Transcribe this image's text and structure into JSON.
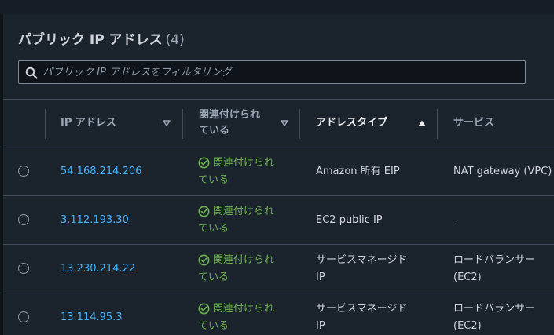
{
  "panel": {
    "title": "パブリック IP アドレス",
    "count": "(4)"
  },
  "search": {
    "placeholder": "パブリック IP アドレスをフィルタリング"
  },
  "table": {
    "columns": [
      {
        "label": "IP アドレス",
        "sortable": true,
        "sorted": false
      },
      {
        "label": "関連付けられている",
        "label_line1": "関連付けられ",
        "label_line2": "ている",
        "sortable": true,
        "sorted": false
      },
      {
        "label": "アドレスタイプ",
        "sortable": true,
        "sorted": "ascending"
      },
      {
        "label": "サービス",
        "sortable": false,
        "sorted": false
      }
    ],
    "rows": [
      {
        "ip": "54.168.214.206",
        "status_line1": "関連付けられ",
        "status_line2": "ている",
        "address_type_line1": "Amazon 所有 EIP",
        "address_type_line2": "",
        "service_line1": "NAT gateway (VPC)",
        "service_line2": ""
      },
      {
        "ip": "3.112.193.30",
        "status_line1": "関連付けられ",
        "status_line2": "ている",
        "address_type_line1": "EC2 public IP",
        "address_type_line2": "",
        "service_line1": "–",
        "service_line2": ""
      },
      {
        "ip": "13.230.214.22",
        "status_line1": "関連付けられ",
        "status_line2": "ている",
        "address_type_line1": "サービスマネージド",
        "address_type_line2": "IP",
        "service_line1": "ロードバランサー",
        "service_line2": "(EC2)"
      },
      {
        "ip": "13.114.95.3",
        "status_line1": "関連付けられ",
        "status_line2": "ている",
        "address_type_line1": "サービスマネージド",
        "address_type_line2": "IP",
        "service_line1": "ロードバランサー",
        "service_line2": "(EC2)"
      }
    ]
  },
  "colors": {
    "link": "#42b4ff",
    "success": "#6ab04c",
    "background": "#1b232d"
  },
  "icons": {
    "search": "search-icon",
    "sort_unsorted": "caret-down-outline-icon",
    "sort_ascending": "caret-up-filled-icon",
    "status": "check-circle-icon"
  }
}
